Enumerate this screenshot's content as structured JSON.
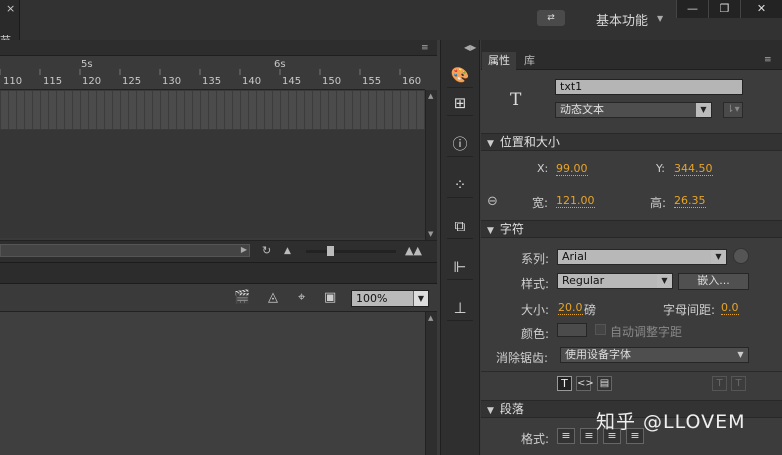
{
  "window": {
    "close_glyph": "×",
    "tab_fragment": "节",
    "sync_label": "⇄",
    "workspace": "基本功能",
    "minimize": "—",
    "restore": "❐",
    "close": "✕"
  },
  "timeline": {
    "menu_glyph": "≡",
    "second_markers": [
      "5s",
      "6s"
    ],
    "frame_ticks": [
      "110",
      "115",
      "120",
      "125",
      "130",
      "135",
      "140",
      "145",
      "150",
      "155",
      "160"
    ],
    "loop_glyph": "↻"
  },
  "stage": {
    "zoom_value": "100%"
  },
  "properties": {
    "tabs": [
      "属性",
      "库"
    ],
    "text_tool_glyph": "T",
    "instance_name": "txt1",
    "text_type": "动态文本",
    "sections": {
      "position": "位置和大小",
      "character": "字符",
      "paragraph": "段落"
    },
    "position": {
      "x_label": "X:",
      "x_value": "99.00",
      "y_label": "Y:",
      "y_value": "344.50",
      "w_label": "宽:",
      "w_value": "121.00",
      "h_label": "高:",
      "h_value": "26.35"
    },
    "character": {
      "family_label": "系列:",
      "family_value": "Arial",
      "style_label": "样式:",
      "style_value": "Regular",
      "embed_button": "嵌入...",
      "size_label": "大小:",
      "size_value": "20.0",
      "size_unit": "磅",
      "spacing_label": "字母间距:",
      "spacing_value": "0.0",
      "color_label": "颜色:",
      "auto_kern_label": "自动调整字距",
      "aa_label": "消除锯齿:",
      "aa_value": "使用设备字体"
    },
    "paragraph": {
      "format_label": "格式:"
    }
  },
  "watermark": "知乎 @LLOVEM",
  "colors": {
    "accent_value": "#e8a427",
    "panel_bg": "#3c3c3c",
    "header_bg": "#333333"
  }
}
